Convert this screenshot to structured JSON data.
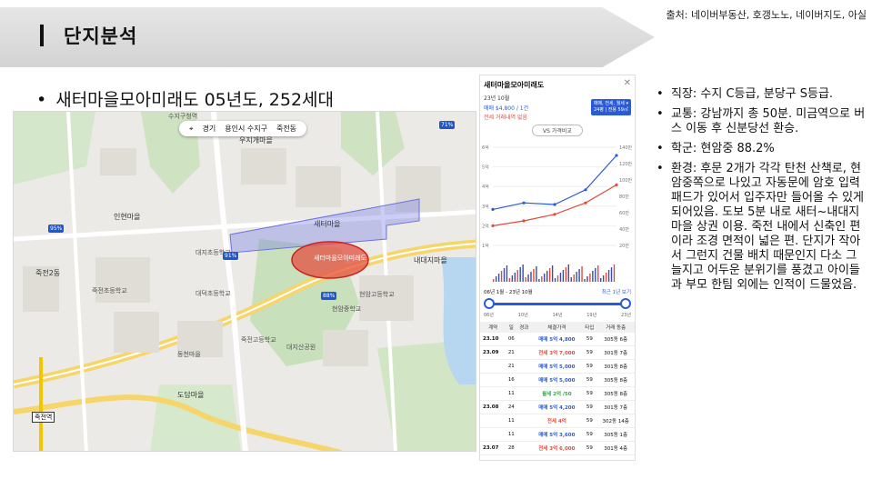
{
  "header": {
    "title": "단지분석",
    "source": "출처: 네이버부동산, 호갱노노, 네이버지도, 아실"
  },
  "title_bullet": "새터마을모아미래도 05년도, 252세대",
  "map": {
    "controls": [
      "경기",
      "용인시 수지구",
      "죽전동"
    ],
    "labels": [
      "수지구청역",
      "우지개마을",
      "인현마을",
      "죽전2동",
      "새터마을",
      "내대지마을",
      "도담마을",
      "죽전역",
      "대지초등학교",
      "죽전초등학교",
      "대덕초등학교",
      "현암고등학교",
      "현암중학교",
      "죽전고등학교",
      "대지산공원",
      "동천마을"
    ],
    "station": "죽전역",
    "highlight": "새터마을모아미래도",
    "pins": [
      "95%",
      "91%",
      "88%",
      "71%"
    ]
  },
  "panel": {
    "title": "새터마을모아미래도",
    "close": "✕",
    "sub": "23년 10월",
    "price": "매매 $4,800 / 1건",
    "none": "전세 거래내역 없음",
    "tabs": "매매, 전세, 월세 ▾\n24평 | 전용 59㎡",
    "vs": "VS 가격비교",
    "range_from": "06년 1월 - 23년 10월",
    "range_link": "최근 1년 보기",
    "ticks": [
      "06년",
      "10년",
      "14년",
      "19년",
      "23년"
    ],
    "y_labels": [
      "6억",
      "5억",
      "4억",
      "3억",
      "2억",
      "1억"
    ],
    "y_right": [
      "140만",
      "120만",
      "100만",
      "80만",
      "60만",
      "40만",
      "20만"
    ],
    "table": {
      "headers": [
        "계약",
        "일",
        "경과",
        "체결가격",
        "타입",
        "거래 동층"
      ],
      "rows": [
        [
          "23.10",
          "06",
          "",
          "매매 5억 4,800",
          "59",
          "305동 6층"
        ],
        [
          "23.09",
          "21",
          "",
          "전세 3억 7,000",
          "59",
          "301동 7층"
        ],
        [
          "",
          "21",
          "",
          "매매 5억 5,000",
          "59",
          "301동 8층"
        ],
        [
          "",
          "16",
          "",
          "매매 5억 5,000",
          "59",
          "305동 8층"
        ],
        [
          "",
          "11",
          "",
          "월세 2억 /50",
          "59",
          "305동 8층"
        ],
        [
          "23.08",
          "24",
          "",
          "매매 5억 4,200",
          "59",
          "301동 7층"
        ],
        [
          "",
          "11",
          "",
          "전세 4억",
          "59",
          "302동 14층"
        ],
        [
          "",
          "11",
          "",
          "매매 5억 3,600",
          "59",
          "305동 1층"
        ],
        [
          "23.07",
          "28",
          "",
          "전세 3억 6,000",
          "59",
          "301동 4층"
        ]
      ]
    }
  },
  "notes": [
    "직장: 수지 C등급, 분당구 S등급.",
    "교통: 강남까지 총 50분. 미금역으로 버스 이동 후 신분당선 환승.",
    "학군: 현암중 88.2%",
    "환경: 후문 2개가 각각 탄천 산책로, 현암중쪽으로 나있고 자동문에 암호 입력패드가 있어서 입주자만 들어올 수 있게 되어있음. 도보 5분 내로 새터~내대지마을 상권 이용. 죽전 내에서 신축인 편이라 조경 면적이 넓은 편. 단지가 작아서 그런지 건물 배치 때문인지 다소 그늘지고 어두운 분위기를 풍겼고 아이들과 부모 한팀 외에는 인적이 드물었음."
  ],
  "colors": {
    "sale": "#2a5bd7",
    "jeonse": "#e04b3c",
    "highlight": "#e0463a"
  },
  "chart_data": {
    "type": "line",
    "x": [
      "06년",
      "10년",
      "14년",
      "19년",
      "23년"
    ],
    "series": [
      {
        "name": "매매",
        "values": [
          2.2,
          2.6,
          2.5,
          3.4,
          5.5
        ]
      },
      {
        "name": "전세",
        "values": [
          1.2,
          1.5,
          1.9,
          2.6,
          3.7
        ]
      }
    ],
    "ylabel": "",
    "ylim": [
      0,
      6
    ]
  }
}
